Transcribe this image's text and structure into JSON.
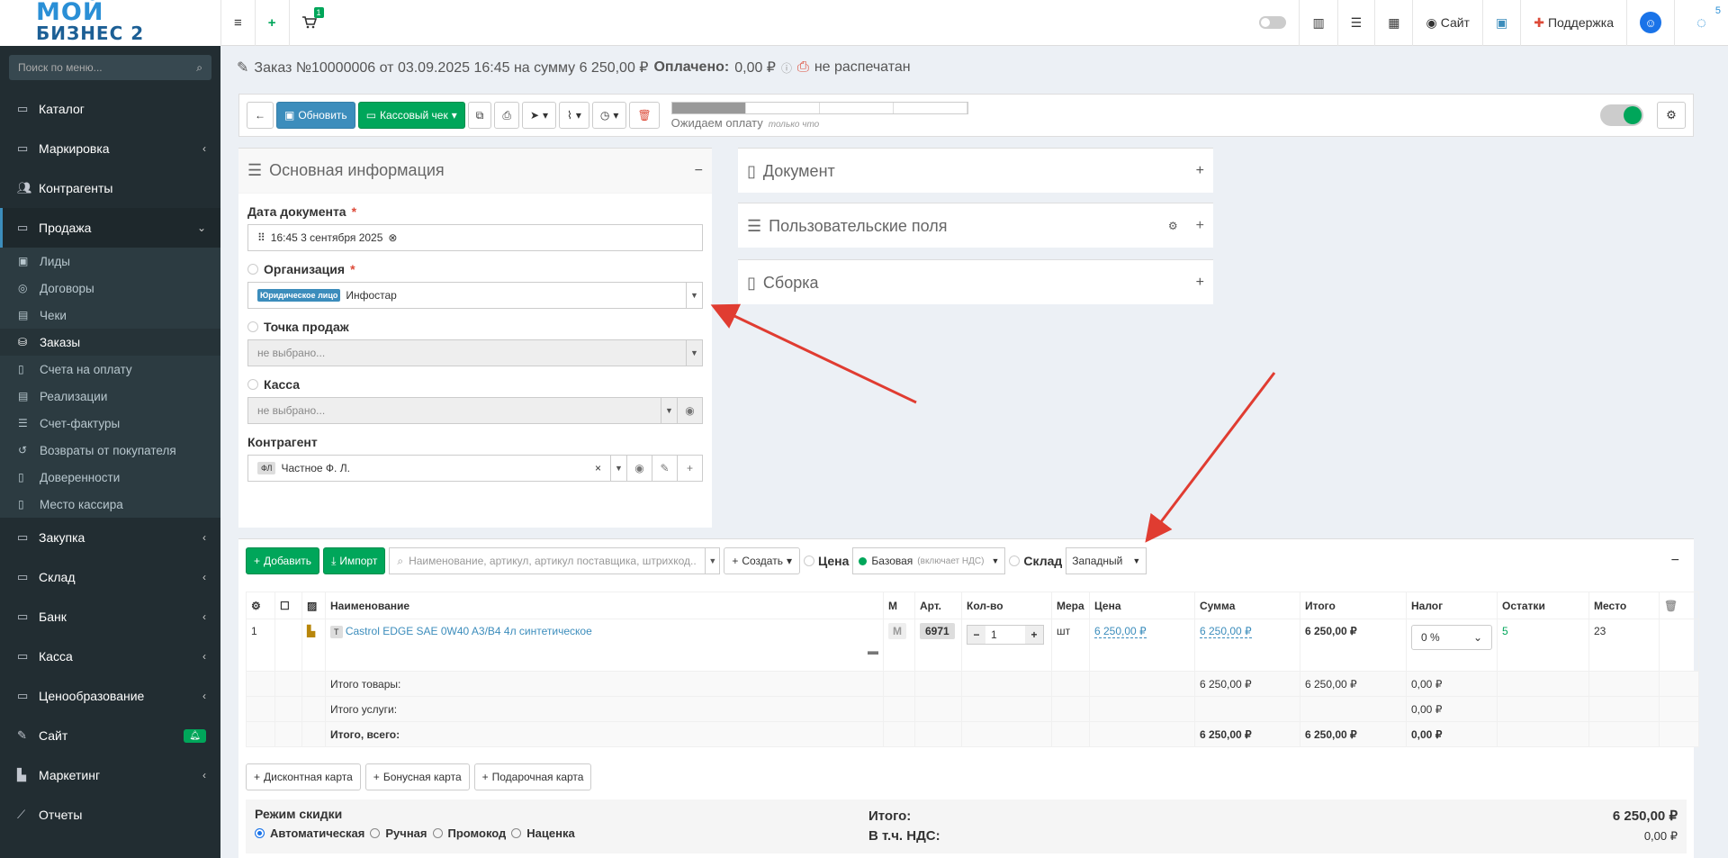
{
  "logo": {
    "line1": "МОЙ",
    "line2": "БИЗНЕС 2"
  },
  "topbar": {
    "cart_count": "1",
    "site_label": "Сайт",
    "support_label": "Поддержка",
    "notif_count": "5"
  },
  "sidebar": {
    "search_placeholder": "Поиск по меню...",
    "items": [
      {
        "label": "Каталог"
      },
      {
        "label": "Маркировка"
      },
      {
        "label": "Контрагенты"
      },
      {
        "label": "Продажа"
      },
      {
        "label": "Закупка"
      },
      {
        "label": "Склад"
      },
      {
        "label": "Банк"
      },
      {
        "label": "Касса"
      },
      {
        "label": "Ценообразование"
      },
      {
        "label": "Сайт"
      },
      {
        "label": "Маркетинг"
      },
      {
        "label": "Отчеты"
      }
    ],
    "sub_items": [
      {
        "label": "Лиды"
      },
      {
        "label": "Договоры"
      },
      {
        "label": "Чеки"
      },
      {
        "label": "Заказы"
      },
      {
        "label": "Счета на оплату"
      },
      {
        "label": "Реализации"
      },
      {
        "label": "Счет-фактуры"
      },
      {
        "label": "Возвраты от покупателя"
      },
      {
        "label": "Доверенности"
      },
      {
        "label": "Место кассира"
      }
    ]
  },
  "header": {
    "title": "Заказ №10000006 от 03.09.2025 16:45 на сумму 6 250,00 ₽",
    "paid_label": "Оплачено:",
    "paid_value": "0,00 ₽",
    "print_status": "не распечатан"
  },
  "toolbar": {
    "refresh_label": "Обновить",
    "receipt_label": "Кассовый чек",
    "status_label": "Ожидаем оплату",
    "status_time": "только что",
    "progress_fraction": 0.25
  },
  "basic_info": {
    "title": "Основная информация",
    "date_label": "Дата документа",
    "date_value": "16:45 3 сентября 2025",
    "org_label": "Организация",
    "org_tag": "Юридическое лицо",
    "org_value": "Инфостар",
    "pos_label": "Точка продаж",
    "pos_value": "не выбрано...",
    "cash_label": "Касса",
    "cash_value": "не выбрано...",
    "contractor_label": "Контрагент",
    "contractor_tag": "ФЛ",
    "contractor_value": "Частное Ф. Л."
  },
  "side_boxes": {
    "document": "Документ",
    "custom_fields": "Пользовательские поля",
    "assembly": "Сборка"
  },
  "products": {
    "add_label": "Добавить",
    "import_label": "Импорт",
    "search_placeholder": "Наименование, артикул, артикул поставщика, штрихкод...",
    "create_label": "Создать",
    "price_label": "Цена",
    "price_value": "Базовая",
    "price_note": "(включает НДС)",
    "warehouse_label": "Склад",
    "warehouse_value": "Западный",
    "columns": [
      "Наименование",
      "М",
      "Арт.",
      "Кол-во",
      "Мера",
      "Цена",
      "Сумма",
      "Итого",
      "Налог",
      "Остатки",
      "Место"
    ],
    "rows": [
      {
        "num": "1",
        "type": "Т",
        "name": "Castrol EDGE SAE 0W40 A3/B4 4л синтетическое",
        "m": "М",
        "art": "6971",
        "qty": "1",
        "unit": "шт",
        "price": "6 250,00 ₽",
        "sum": "6 250,00 ₽",
        "total": "6 250,00 ₽",
        "tax": "0 %",
        "stock": "5",
        "place": "23"
      }
    ],
    "summary": [
      {
        "label": "Итого товары:",
        "sum": "6 250,00 ₽",
        "total": "6 250,00 ₽",
        "tax": "0,00 ₽"
      },
      {
        "label": "Итого услуги:",
        "sum": "",
        "total": "",
        "tax": "0,00 ₽"
      },
      {
        "label": "Итого, всего:",
        "sum": "6 250,00 ₽",
        "total": "6 250,00 ₽",
        "tax": "0,00 ₽"
      }
    ],
    "discount_card": "Дисконтная карта",
    "bonus_card": "Бонусная карта",
    "gift_card": "Подарочная карта"
  },
  "discount": {
    "title": "Режим скидки",
    "opt_auto": "Автоматическая",
    "opt_manual": "Ручная",
    "opt_promo": "Промокод",
    "opt_markup": "Наценка",
    "total_label": "Итого:",
    "vat_label": "В т.ч. НДС:",
    "total_value": "6 250,00 ₽",
    "vat_value": "0,00 ₽"
  },
  "colors": {
    "accent": "#3c8dbc",
    "success": "#00a65a",
    "danger": "#dd4b39",
    "sidebar": "#222d32",
    "arrow": "#e03c31"
  }
}
